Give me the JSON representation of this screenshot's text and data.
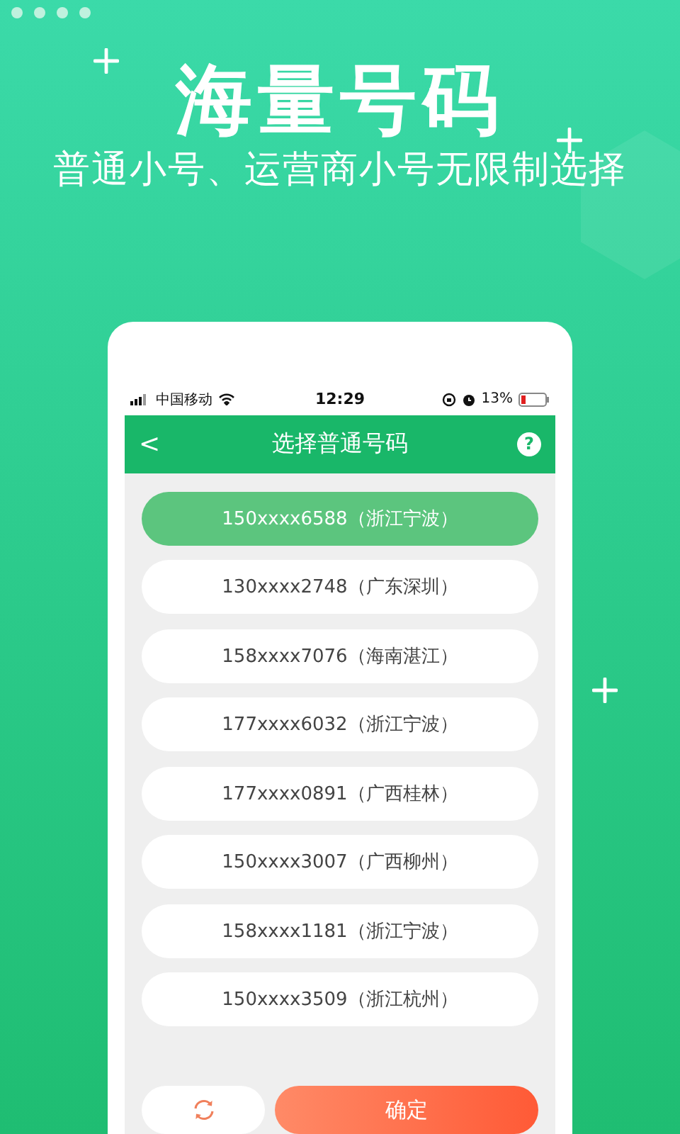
{
  "headline": "海量号码",
  "subtitle": "普通小号、运营商小号无限制选择",
  "status_bar": {
    "carrier": "中国移动",
    "time": "12:29",
    "battery": "13%"
  },
  "header": {
    "back": "<",
    "title": "选择普通号码",
    "help": "?"
  },
  "numbers": [
    {
      "label": "150xxxx6588（浙江宁波）",
      "selected": true
    },
    {
      "label": "130xxxx2748（广东深圳）",
      "selected": false
    },
    {
      "label": "158xxxx7076（海南湛江）",
      "selected": false
    },
    {
      "label": "177xxxx6032（浙江宁波）",
      "selected": false
    },
    {
      "label": "177xxxx0891（广西桂林）",
      "selected": false
    },
    {
      "label": "150xxxx3007（广西柳州）",
      "selected": false
    },
    {
      "label": "158xxxx1181（浙江宁波）",
      "selected": false
    },
    {
      "label": "150xxxx3509（浙江杭州）",
      "selected": false
    }
  ],
  "confirm_button": "确定"
}
